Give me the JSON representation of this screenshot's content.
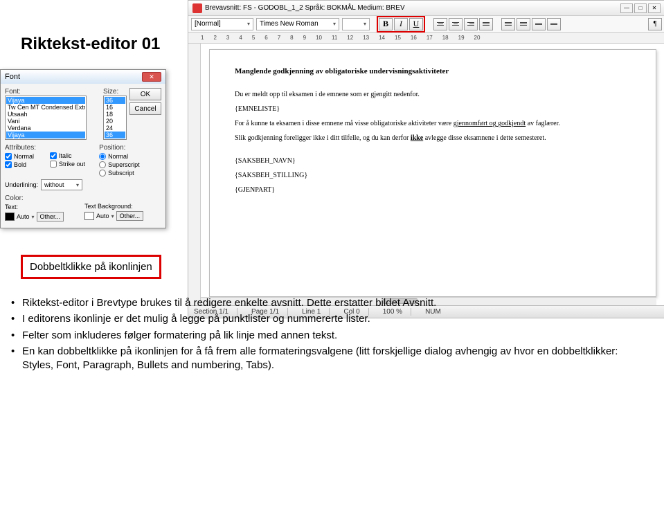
{
  "slide": {
    "title": "Riktekst-editor 01",
    "note": "Dobbeltklikke på ikonlinjen",
    "bullets": [
      "Riktekst-editor i Brevtype brukes til å redigere enkelte avsnitt. Dette erstatter bildet Avsnitt.",
      "I editorens ikonlinje er det mulig å legge på punktlister og nummererte lister.",
      "Felter som inkluderes følger formatering på lik linje med annen tekst.",
      "En kan dobbeltklikke på ikonlinjen for å få frem alle formateringsvalgene (litt forskjellige dialog avhengig av hvor en dobbeltklikker: Styles, Font, Paragraph, Bullets and numbering, Tabs)."
    ]
  },
  "editor": {
    "title": "Brevavsnitt: FS - GODOBL_1_2 Språk: BOKMÅL Medium: BREV",
    "style": "[Normal]",
    "font": "Times New Roman",
    "size": "",
    "bold": "B",
    "italic": "I",
    "underline": "U",
    "ruler": [
      "1",
      "2",
      "3",
      "4",
      "5",
      "6",
      "7",
      "8",
      "9",
      "10",
      "11",
      "12",
      "13",
      "14",
      "15",
      "16",
      "17",
      "18",
      "19",
      "20"
    ],
    "doc": {
      "heading": "Manglende godkjenning av obligatoriske undervisningsaktiviteter",
      "p1": "Du er meldt opp til eksamen i de emnene som er gjengitt nedenfor.",
      "p2": "{EMNELISTE}",
      "p3a": "For å kunne ta eksamen i disse emnene må visse obligatoriske aktiviteter være ",
      "p3b": "gjennomført og godkjendt",
      "p3c": " av faglærer.",
      "p4a": "Slik godkjenning foreligger ikke i ditt tilfelle, og du kan derfor ",
      "p4b": "ikke",
      "p4c": " avlegge disse eksamnene i dette semesteret.",
      "p5": "{SAKSBEH_NAVN}",
      "p6": "{SAKSBEH_STILLING}",
      "p7": "{GJENPART}"
    },
    "status": {
      "section": "Section 1/1",
      "page": "Page 1/1",
      "line": "Line 1",
      "col": "Col 0",
      "zoom": "100 %",
      "mode": "NUM"
    }
  },
  "fontdlg": {
    "title": "Font",
    "lbl_font": "Font:",
    "lbl_size": "Size:",
    "ok": "OK",
    "cancel": "Cancel",
    "fonts": [
      "Vijaya",
      "Tw Cen MT Condensed Extra Bold",
      "Utsaah",
      "Vani",
      "Verdana",
      "Vijaya"
    ],
    "sizes": [
      "36",
      "16",
      "18",
      "20",
      "24",
      "36"
    ],
    "lbl_attr": "Attributes:",
    "cb_normal": "Normal",
    "cb_italic": "Italic",
    "cb_bold": "Bold",
    "cb_strike": "Strike out",
    "lbl_pos": "Position:",
    "rb_normal": "Normal",
    "rb_super": "Superscript",
    "rb_sub": "Subscript",
    "lbl_under": "Underlining:",
    "under_val": "without",
    "lbl_color": "Color:",
    "lbl_text": "Text:",
    "lbl_bg": "Text Background:",
    "auto": "Auto",
    "other": "Other..."
  }
}
